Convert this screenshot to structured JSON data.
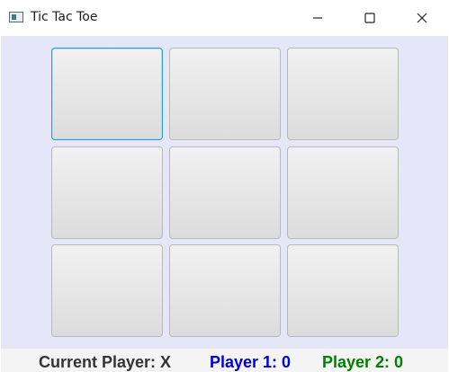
{
  "window": {
    "title": "Tic Tac Toe",
    "icon": "app-icon"
  },
  "controls": {
    "minimize_icon": "minimize-icon",
    "maximize_icon": "maximize-icon",
    "close_icon": "close-icon"
  },
  "board": {
    "cells": [
      "",
      "",
      "",
      "",
      "",
      "",
      "",
      "",
      ""
    ],
    "focused_cell_index": 0
  },
  "status": {
    "current_player": "Current Player: X",
    "player1": "Player 1: 0",
    "player2": "Player 2: 0"
  },
  "colors": {
    "board_background": "#e6e6f9",
    "focus_border": "#2b9be0",
    "player1": "#0000d4",
    "player2": "#008000",
    "current": "#333333"
  }
}
